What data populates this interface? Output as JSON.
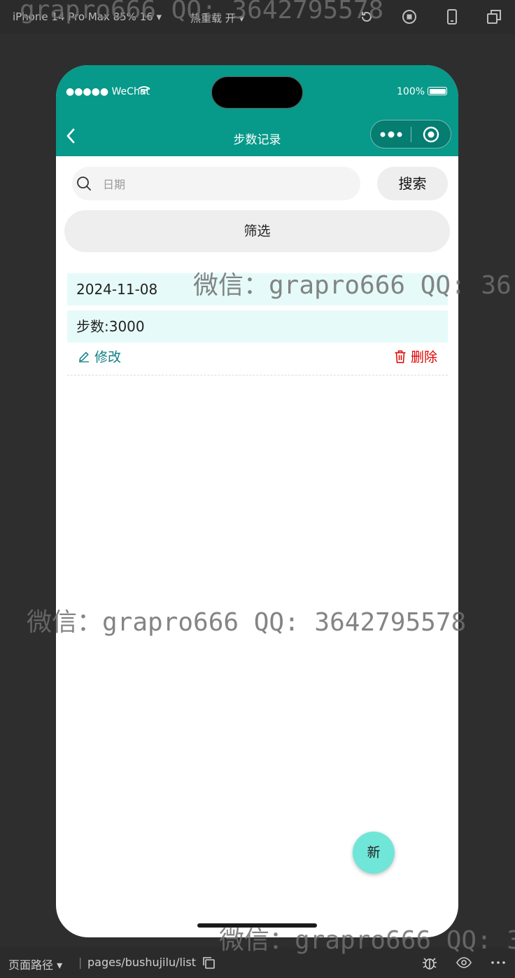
{
  "devtools": {
    "device_label": "iPhone 14 Pro Max 85% 16 ▾",
    "hot_reload_label": "热重载 开 ▾",
    "path_label": "页面路径 ▾",
    "separator": "|",
    "path_value": "pages/bushujilu/list"
  },
  "status_bar": {
    "signal_text": "●●●●● WeChat",
    "battery_text": "100%"
  },
  "navbar": {
    "title": "步数记录"
  },
  "search": {
    "placeholder": "日期",
    "value": "",
    "button_label": "搜索"
  },
  "filter": {
    "label": "筛选"
  },
  "records": [
    {
      "date": "2024-11-08",
      "steps": "步数:3000",
      "edit_label": "修改",
      "delete_label": "删除"
    }
  ],
  "fab": {
    "label": "新"
  },
  "watermarks": [
    "grapro666 QQ: 3642795578",
    "微信：grapro666 QQ: 36",
    "微信：grapro666 QQ: 3642795578",
    "微信：grapro666 QQ: 3"
  ],
  "colors": {
    "brand": "#07998a",
    "record_bg": "#e6fbf9",
    "edit": "#0d7f86",
    "delete": "#e00000",
    "fab": "#70e6d8"
  },
  "icons": {
    "back": "chevron-left-icon",
    "search": "search-icon",
    "edit": "pencil-icon",
    "delete": "trash-icon",
    "more": "more-dots-icon",
    "close": "target-circle-icon"
  }
}
